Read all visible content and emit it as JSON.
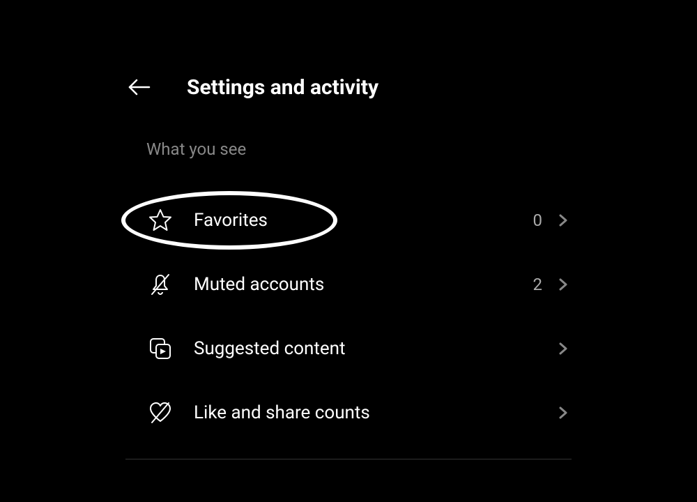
{
  "header": {
    "title": "Settings and activity"
  },
  "section": {
    "label": "What you see"
  },
  "menu": {
    "items": [
      {
        "label": "Favorites",
        "value": "0"
      },
      {
        "label": "Muted accounts",
        "value": "2"
      },
      {
        "label": "Suggested content",
        "value": null
      },
      {
        "label": "Like and share counts",
        "value": null
      }
    ]
  }
}
